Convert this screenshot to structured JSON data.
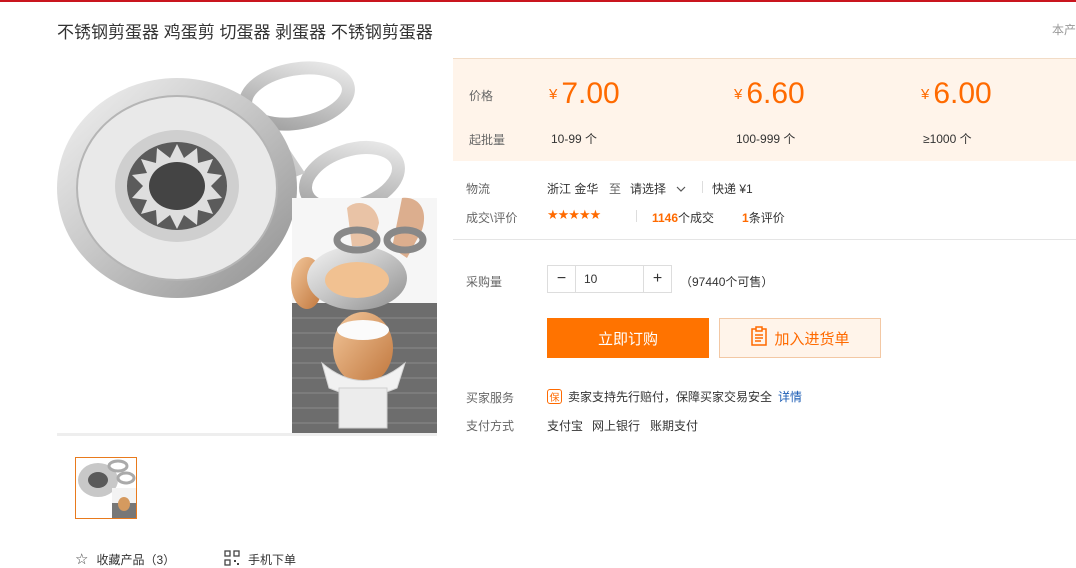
{
  "title": "不锈钢剪蛋器 鸡蛋剪 切蛋器 剥蛋器 不锈钢剪蛋器",
  "corner_text": "本产",
  "price_box": {
    "price_label": "价格",
    "moq_label": "起批量",
    "currency": "¥",
    "tiers": [
      {
        "price": "7.00",
        "qty": "10-99 个"
      },
      {
        "price": "6.60",
        "qty": "100-999 个"
      },
      {
        "price": "6.00",
        "qty": "≥1000 个"
      }
    ]
  },
  "logistics": {
    "label": "物流",
    "origin": "浙江 金华",
    "to": "至",
    "destination": "请选择",
    "express": "快递 ¥1"
  },
  "rating": {
    "label": "成交\\评价",
    "stars": 5,
    "deals_count": "1146",
    "deals_suffix": "个成交",
    "reviews_count": "1",
    "reviews_suffix": "条评价"
  },
  "purchase": {
    "label": "采购量",
    "quantity": "10",
    "stock": "（97440个可售）"
  },
  "buttons": {
    "buy_now": "立即订购",
    "add_to_list": "加入进货单"
  },
  "service": {
    "label": "买家服务",
    "badge": "保",
    "text": "卖家支持先行赔付，保障买家交易安全",
    "link": "详情"
  },
  "payment": {
    "label": "支付方式",
    "methods": [
      "支付宝",
      "网上银行",
      "账期支付"
    ]
  },
  "gallery": {
    "favorite_label": "收藏产品（3）",
    "mobile_label": "手机下单"
  },
  "colors": {
    "accent": "#ff6a00",
    "price_bg": "#fff4ea",
    "link": "#1b5cb5"
  },
  "icons": {
    "favorite": "star-outline-icon",
    "mobile": "qr-code-icon",
    "cart": "clipboard-list-icon",
    "dropdown": "chevron-down-icon",
    "guarantee": "shield-badge-icon"
  }
}
